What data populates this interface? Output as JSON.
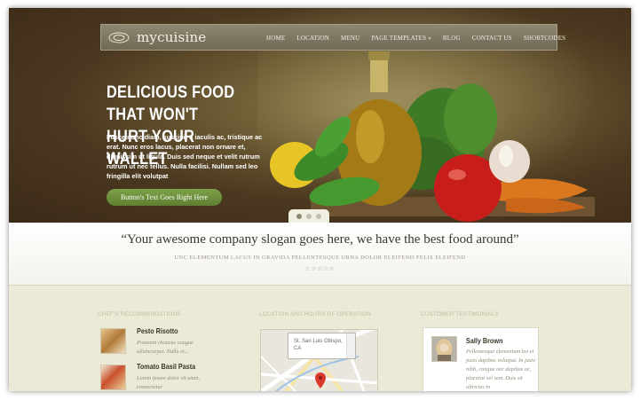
{
  "header": {
    "logo_text": "mycuisine",
    "nav": [
      "HOME",
      "LOCATION",
      "MENU",
      "PAGE TEMPLATES »",
      "BLOG",
      "CONTACT US",
      "SHORTCODES"
    ]
  },
  "hero": {
    "headline_line1": "DELICIOUS FOOD THAT WON'T",
    "headline_line2": "HURT YOUR WALLET",
    "text": "Fusce nunc diam, suscipit a iaculis ac, tristique ac erat. Nunc eros lacus, placerat non ornare et, dignissim ut ligula. Duis sed neque et velit rutrum rutrum ut nec tellus. Nulla facilisi. Nullam sed leo fringilla elit volutpat",
    "button_label": "Button's Text Goes Right Here",
    "slider_dots": 3,
    "active_dot": 1
  },
  "slogan": {
    "title": "“Your awesome company slogan goes here, we have the best food around”",
    "subtitle": "UNC ELEMENTUM LACUS IN GRAVIDA PELLENTESQUE URNA DOLOR ELEIFEND FELIS ELEIFEND",
    "stars": "☆☆☆☆☆"
  },
  "recommendations": {
    "title": "CHEF'S RECOMMENDATIONS",
    "items": [
      {
        "name": "Pesto Risotto",
        "desc": "Praesent rhoncus congue ullamcorper. Nulla et..."
      },
      {
        "name": "Tomato Basil Pasta",
        "desc": "Lorem ipsum dolor sit amet, consectetur"
      }
    ]
  },
  "location": {
    "title": "LOCATION AND HOURS OF OPERATION",
    "popup_text": "St. San Luis Obispo, CA",
    "road_label": "Luis Obispo Creek"
  },
  "testimonials": {
    "title": "CUSTOMER TESTIMONIALS",
    "name": "Sally Brown",
    "text": "Pellentesque elementum leo et justo dapibus volutpat. In justo nibh, congue nec dapibus ac, placerat vel sem. Duis sit ultricies in"
  },
  "colors": {
    "accent_green": "#6e9140",
    "navbar": "#7c7560",
    "hero_dark": "#3b2a18"
  }
}
